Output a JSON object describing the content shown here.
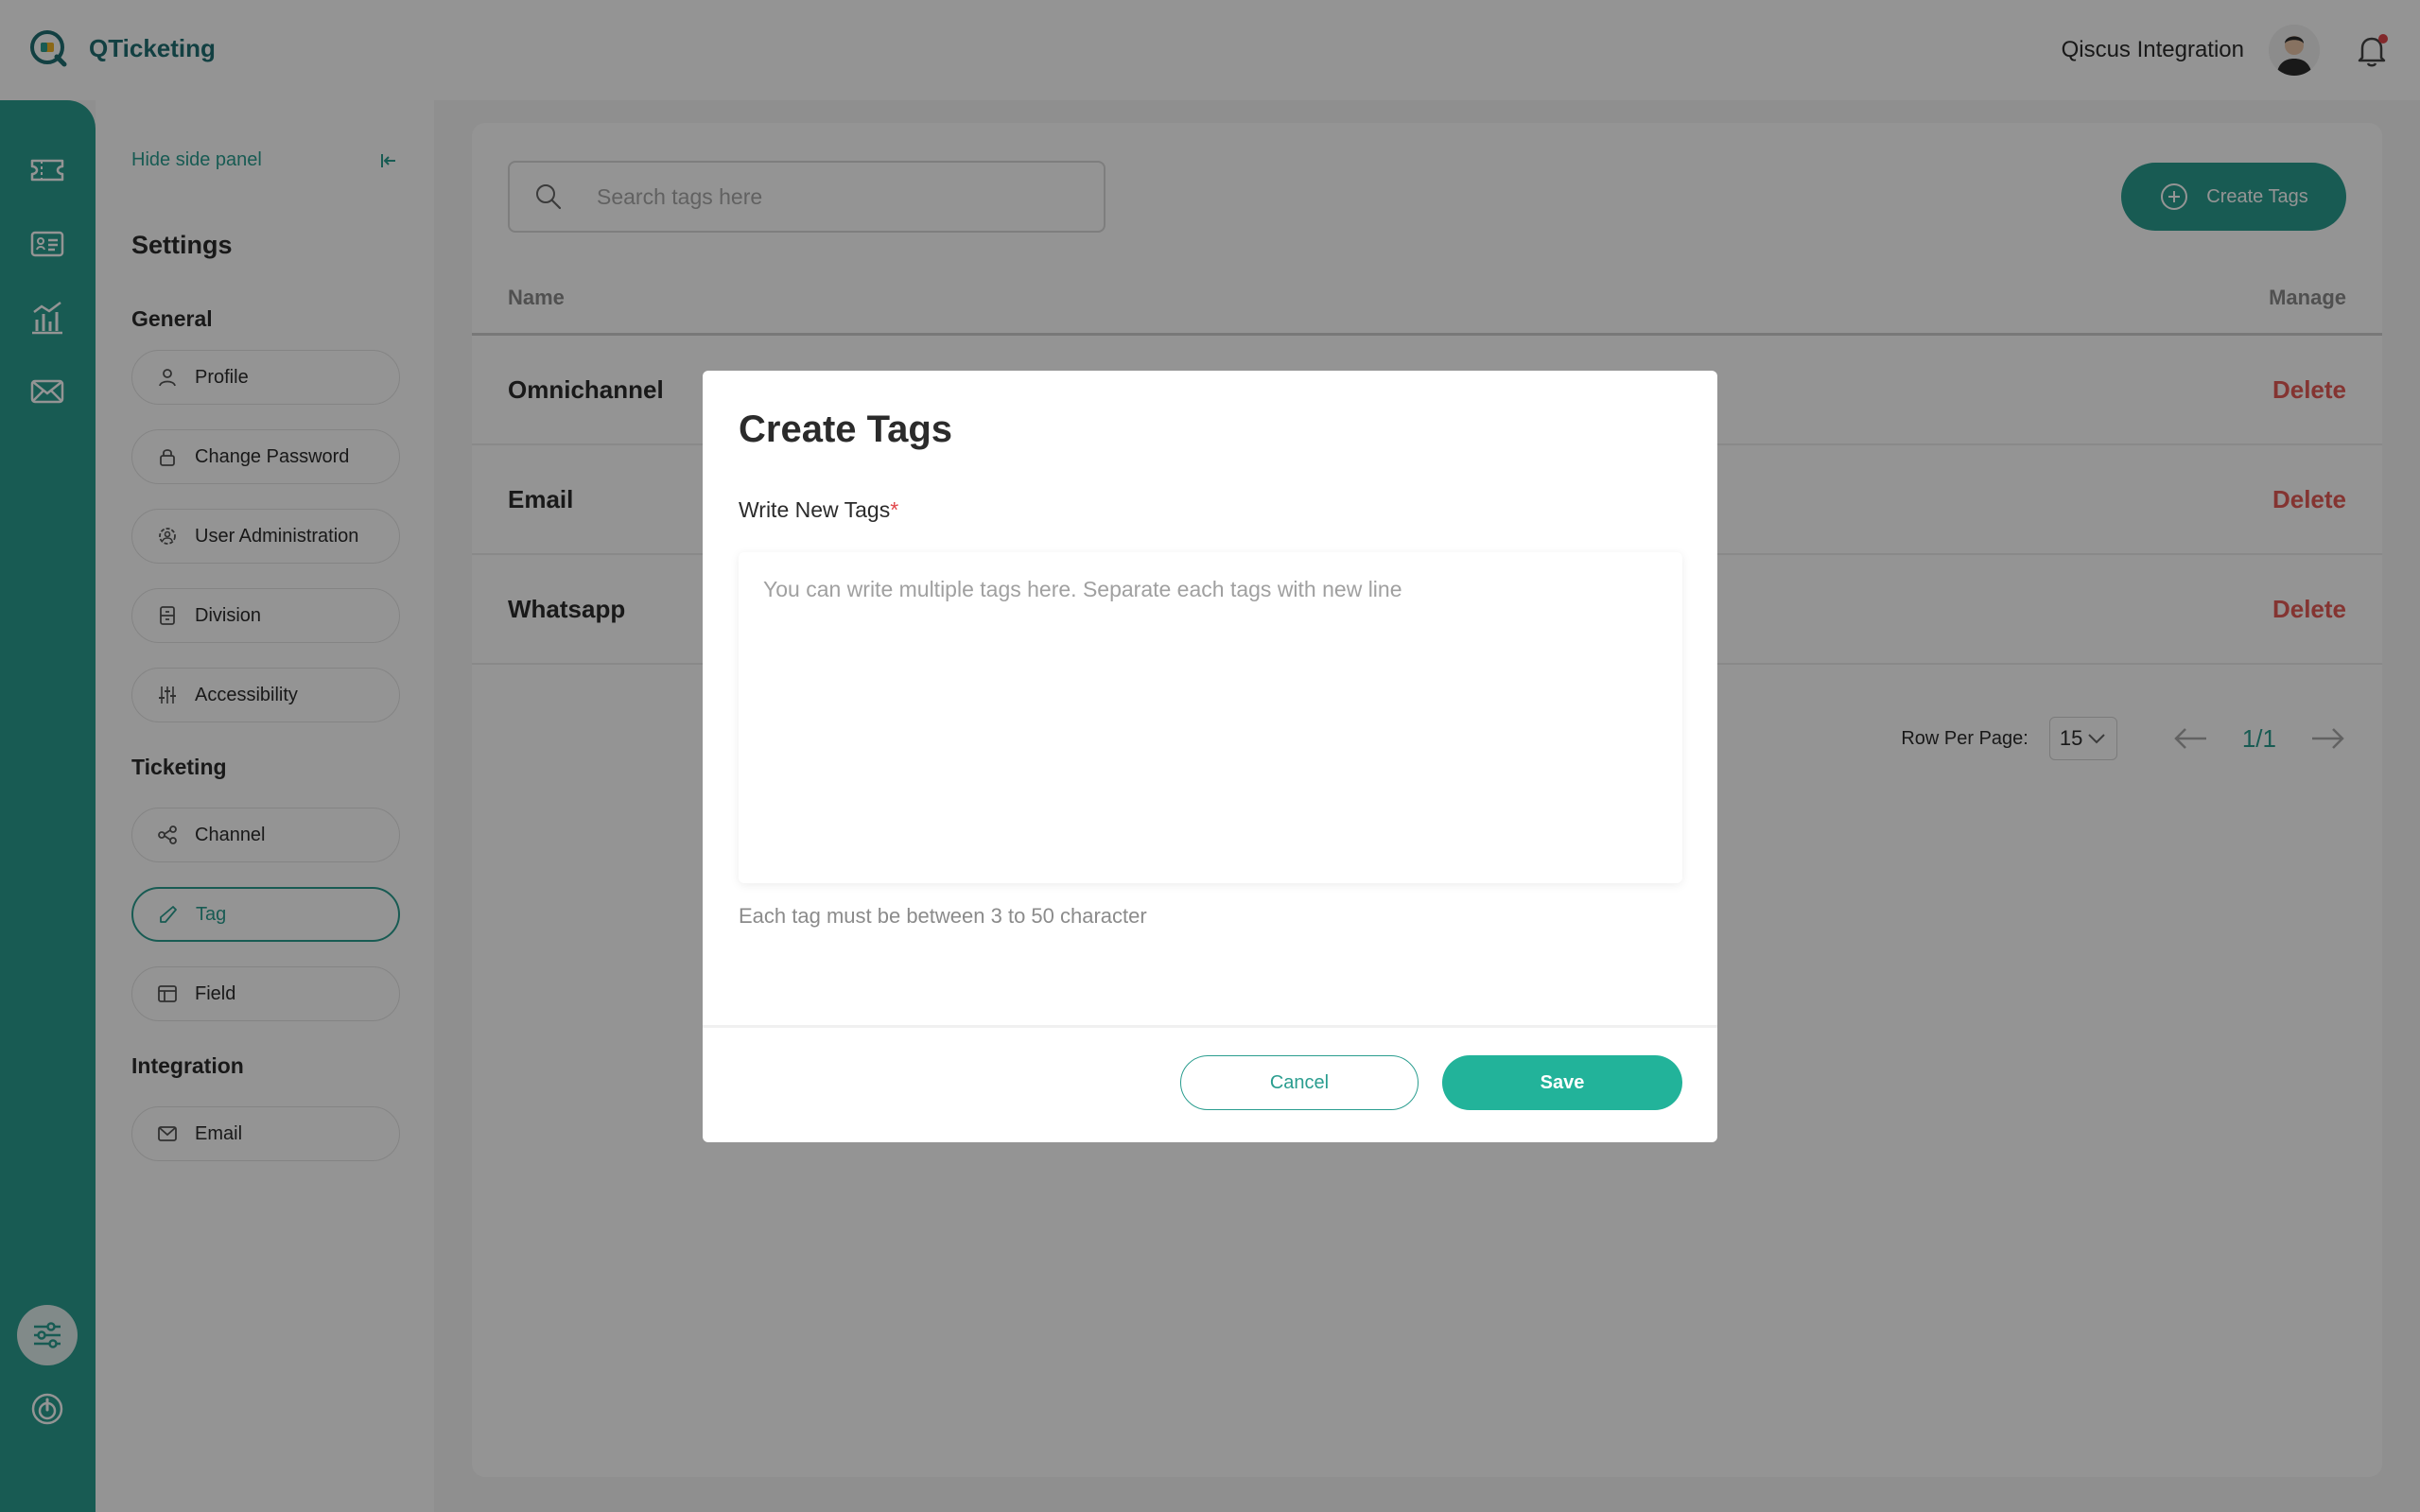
{
  "app": {
    "name": "QTicketing"
  },
  "header": {
    "user_name": "Qiscus Integration"
  },
  "rail": {
    "icons": [
      "ticket-icon",
      "contact-card-icon",
      "analytics-icon",
      "mail-icon",
      "settings-sliders-icon",
      "power-icon"
    ]
  },
  "side_panel": {
    "hide_label": "Hide side panel",
    "title": "Settings",
    "sections": {
      "general": "General",
      "ticketing": "Ticketing",
      "integration": "Integration"
    },
    "items": {
      "profile": "Profile",
      "change_password": "Change Password",
      "user_admin": "User Administration",
      "division": "Division",
      "accessibility": "Accessibility",
      "channel": "Channel",
      "tag": "Tag",
      "field": "Field",
      "email": "Email"
    },
    "active_item": "Tag"
  },
  "main": {
    "search_placeholder": "Search tags here",
    "create_button": "Create Tags",
    "columns": {
      "name": "Name",
      "manage": "Manage"
    },
    "rows": [
      {
        "name": "Omnichannel",
        "action": "Delete"
      },
      {
        "name": "Email",
        "action": "Delete"
      },
      {
        "name": "Whatsapp",
        "action": "Delete"
      }
    ],
    "pagination": {
      "label": "Row Per Page:",
      "rows_per_page": "15",
      "page": "1/1"
    }
  },
  "modal": {
    "title": "Create Tags",
    "field_label": "Write New Tags",
    "required_mark": "*",
    "textarea_placeholder": "You can write multiple tags here. Separate each tags with new line",
    "hint": "Each tag must be between 3 to 50 character",
    "cancel": "Cancel",
    "save": "Save"
  },
  "colors": {
    "accent": "#2a9d8f",
    "save": "#22b39a",
    "danger": "#e45a55",
    "brand": "#1f6f73"
  }
}
